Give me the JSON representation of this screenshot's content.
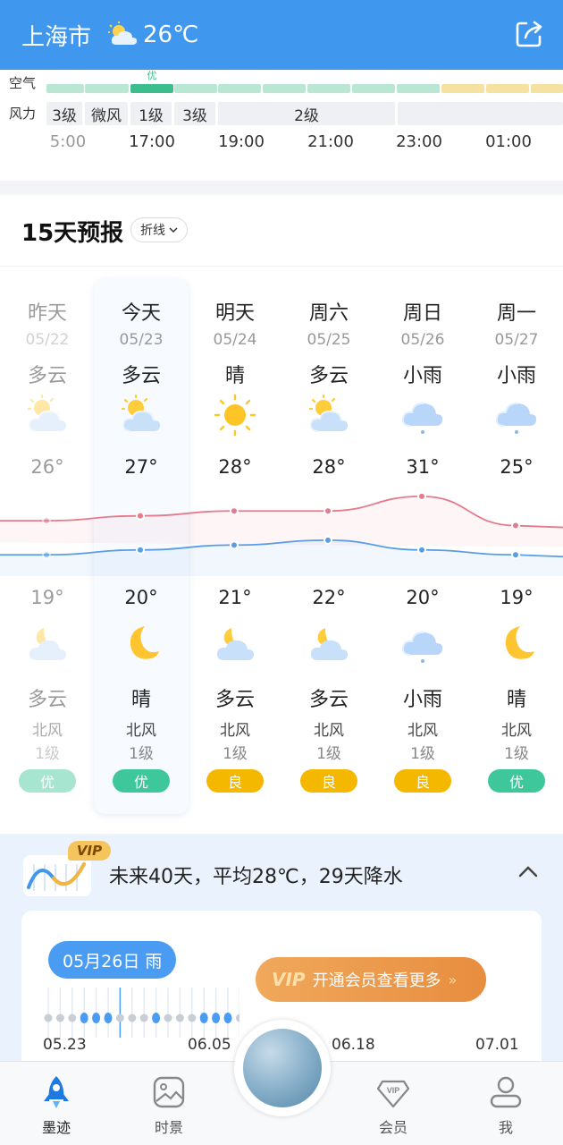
{
  "header": {
    "city": "上海市",
    "temperature": "26℃",
    "weather_icon": "partly-cloudy-icon",
    "share_icon": "share-icon"
  },
  "hourly": {
    "aq_label": "空气",
    "aq_tip": "优",
    "wind_label": "风力",
    "wind_values": [
      "3级",
      "微风",
      "1级",
      "3级",
      "2级"
    ],
    "times": [
      "5:00",
      "17:00",
      "19:00",
      "21:00",
      "23:00",
      "01:00"
    ],
    "aq_colors": {
      "good": "#3bbd8e",
      "moderate": "#f7c843"
    }
  },
  "forecast": {
    "title": "15天预报",
    "view_toggle": "折线",
    "days": [
      {
        "name": "昨天",
        "date": "05/22",
        "day_cond": "多云",
        "day_icon": "partly-cloudy-icon",
        "high": "26°",
        "low": "19°",
        "night_icon": "partly-cloudy-night-icon",
        "night_cond": "多云",
        "wind_dir": "北风",
        "wind_level": "1级",
        "aq": "优"
      },
      {
        "name": "今天",
        "date": "05/23",
        "day_cond": "多云",
        "day_icon": "partly-cloudy-icon",
        "high": "27°",
        "low": "20°",
        "night_icon": "moon-icon",
        "night_cond": "晴",
        "wind_dir": "北风",
        "wind_level": "1级",
        "aq": "优"
      },
      {
        "name": "明天",
        "date": "05/24",
        "day_cond": "晴",
        "day_icon": "sun-icon",
        "high": "28°",
        "low": "21°",
        "night_icon": "partly-cloudy-night-icon",
        "night_cond": "多云",
        "wind_dir": "北风",
        "wind_level": "1级",
        "aq": "良"
      },
      {
        "name": "周六",
        "date": "05/25",
        "day_cond": "多云",
        "day_icon": "partly-cloudy-icon",
        "high": "28°",
        "low": "22°",
        "night_icon": "partly-cloudy-night-icon",
        "night_cond": "多云",
        "wind_dir": "北风",
        "wind_level": "1级",
        "aq": "良"
      },
      {
        "name": "周日",
        "date": "05/26",
        "day_cond": "小雨",
        "day_icon": "light-rain-icon",
        "high": "31°",
        "low": "20°",
        "night_icon": "light-rain-icon",
        "night_cond": "小雨",
        "wind_dir": "北风",
        "wind_level": "1级",
        "aq": "良"
      },
      {
        "name": "周一",
        "date": "05/27",
        "day_cond": "小雨",
        "day_icon": "light-rain-icon",
        "high": "25°",
        "low": "19°",
        "night_icon": "moon-icon",
        "night_cond": "晴",
        "wind_dir": "北风",
        "wind_level": "1级",
        "aq": "优"
      }
    ],
    "high_temps": [
      26,
      27,
      28,
      28,
      31,
      25
    ],
    "low_temps": [
      19,
      20,
      21,
      22,
      20,
      19
    ],
    "colors": {
      "aq_good": "#3ec79a",
      "aq_moderate": "#f5b800",
      "high_line": "#e57a8c",
      "low_line": "#5a9de6"
    }
  },
  "longterm": {
    "vip_badge": "VIP",
    "summary": "未来40天，平均28℃，29天降水",
    "selected_day": "05月26日 雨",
    "vip_button": "开通会员查看更多",
    "vip_logo": "VIP",
    "dates": [
      "05.23",
      "06.05",
      "06.18",
      "07.01"
    ]
  },
  "nav": {
    "items": [
      {
        "label": "墨迹",
        "icon": "rocket-icon"
      },
      {
        "label": "时景",
        "icon": "photo-icon"
      },
      {
        "label": "会员",
        "icon": "vip-diamond-icon"
      },
      {
        "label": "我",
        "icon": "user-icon"
      }
    ]
  }
}
